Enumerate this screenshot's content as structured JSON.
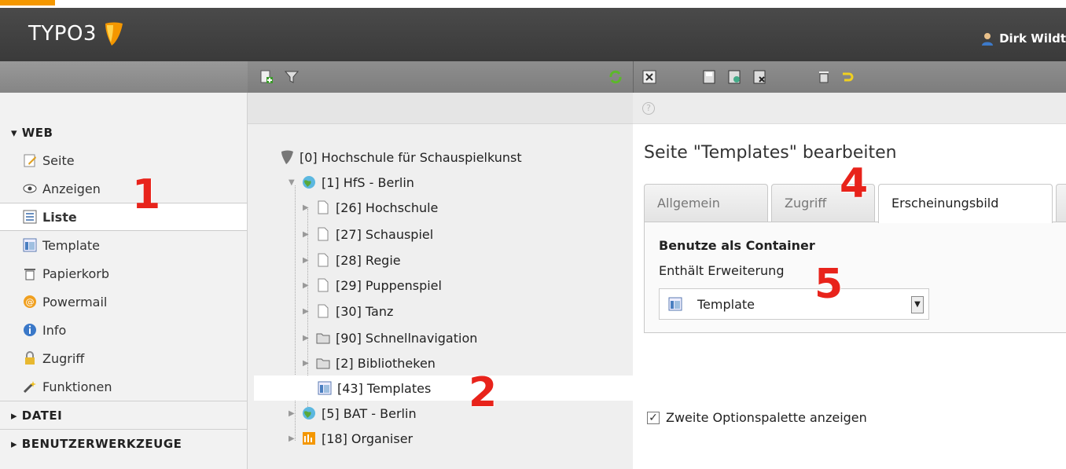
{
  "header": {
    "logo_text": "TYPO3",
    "user_name": "Dirk Wildt"
  },
  "sidebar": {
    "web_section": "WEB",
    "items": [
      {
        "label": "Seite",
        "icon": "page-edit-icon"
      },
      {
        "label": "Anzeigen",
        "icon": "eye-icon"
      },
      {
        "label": "Liste",
        "icon": "list-icon"
      },
      {
        "label": "Template",
        "icon": "template-icon"
      },
      {
        "label": "Papierkorb",
        "icon": "trash-icon"
      },
      {
        "label": "Powermail",
        "icon": "powermail-icon"
      },
      {
        "label": "Info",
        "icon": "info-icon"
      },
      {
        "label": "Zugriff",
        "icon": "lock-icon"
      },
      {
        "label": "Funktionen",
        "icon": "wand-icon"
      }
    ],
    "collapsed_sections": [
      "DATEI",
      "BENUTZERWERKZEUGE"
    ]
  },
  "tree": {
    "nodes": [
      {
        "label": "[0] Hochschule für Schauspielkunst",
        "icon": "typo3-root-icon"
      },
      {
        "label": "[1] HfS - Berlin",
        "icon": "globe-icon"
      },
      {
        "label": "[26] Hochschule",
        "icon": "page-icon"
      },
      {
        "label": "[27] Schauspiel",
        "icon": "page-icon"
      },
      {
        "label": "[28] Regie",
        "icon": "page-icon"
      },
      {
        "label": "[29] Puppenspiel",
        "icon": "page-icon"
      },
      {
        "label": "[30] Tanz",
        "icon": "page-icon"
      },
      {
        "label": "[90] Schnellnavigation",
        "icon": "folder-icon"
      },
      {
        "label": "[2] Bibliotheken",
        "icon": "folder-icon"
      },
      {
        "label": "[43] Templates",
        "icon": "template-page-icon"
      },
      {
        "label": "[5] BAT - Berlin",
        "icon": "globe-icon"
      },
      {
        "label": "[18] Organiser",
        "icon": "organiser-icon"
      }
    ]
  },
  "content": {
    "page_title": "Seite \"Templates\" bearbeiten",
    "tabs": [
      "Allgemein",
      "Zugriff",
      "Erscheinungsbild"
    ],
    "active_tab": "Erscheinungsbild",
    "fieldset_label": "Benutze als Container",
    "field_label": "Enthält Erweiterung",
    "select_value": "Template",
    "checkbox_label": "Zweite Optionspalette anzeigen",
    "checkbox_checked": true
  },
  "annotations": [
    "1",
    "2",
    "4",
    "5"
  ],
  "colors": {
    "accent_orange": "#f49700",
    "annotation_red": "#e8231b",
    "header_dark": "#3a3a3a"
  }
}
